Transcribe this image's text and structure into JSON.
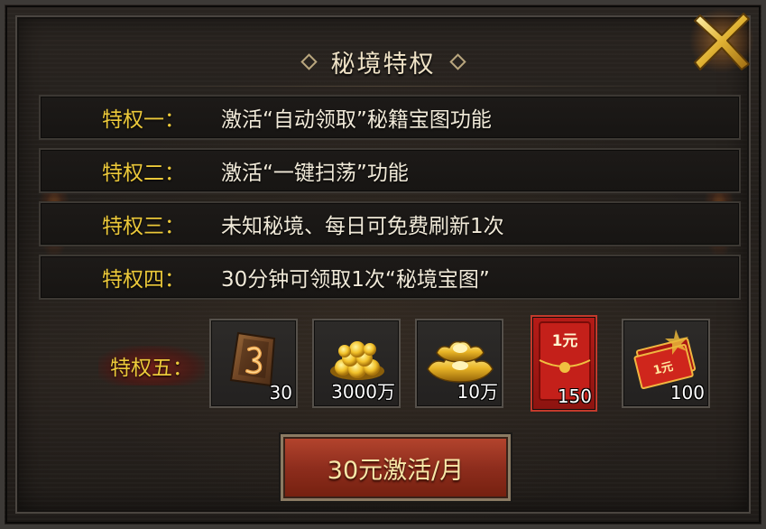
{
  "dialog": {
    "title": "秘境特权"
  },
  "privileges": [
    {
      "label": "特权一：",
      "desc": "激活“自动领取”秘籍宝图功能"
    },
    {
      "label": "特权二：",
      "desc": "激活“一键扫荡”功能"
    },
    {
      "label": "特权三：",
      "desc": "未知秘境、每日可免费刷新1次"
    },
    {
      "label": "特权四：",
      "desc": "30分钟可领取1次“秘境宝图”"
    }
  ],
  "rewards": {
    "label": "特权五：",
    "items": [
      {
        "icon": "treasure-map-scroll-icon",
        "qty": "30"
      },
      {
        "icon": "gold-coins-pile-icon",
        "qty": "3000万"
      },
      {
        "icon": "gold-ingots-icon",
        "qty": "10万"
      },
      {
        "icon": "red-envelope-icon",
        "qty": "150",
        "icon_text": "1元",
        "selected": true
      },
      {
        "icon": "red-packet-bundle-icon",
        "qty": "100",
        "icon_text": "1元"
      }
    ]
  },
  "action": {
    "label": "30元激活/月"
  },
  "colors": {
    "gold_label": "#ecc93a",
    "description": "#f1ead9",
    "button_red": "#8e2d1d",
    "button_text": "#f7e7a8"
  }
}
